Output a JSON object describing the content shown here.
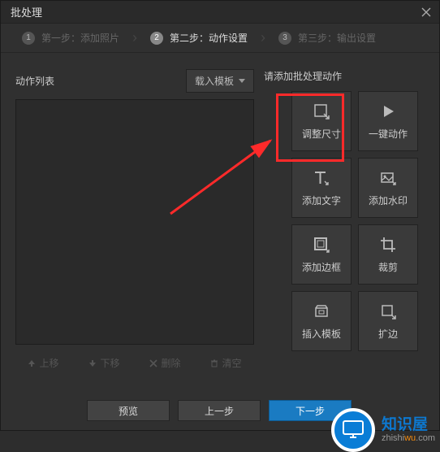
{
  "window": {
    "title": "批处理",
    "close_label": "×"
  },
  "steps": {
    "s1": {
      "num": "1",
      "label": "第一步：添加照片"
    },
    "s2": {
      "num": "2",
      "label": "第二步：动作设置"
    },
    "s3": {
      "num": "3",
      "label": "第三步：输出设置"
    }
  },
  "left": {
    "list_label": "动作列表",
    "template_btn": "载入模板",
    "up": "上移",
    "down": "下移",
    "delete": "删除",
    "clear": "清空"
  },
  "right": {
    "title": "请添加批处理动作",
    "tiles": {
      "resize": "调整尺寸",
      "oneclick": "一键动作",
      "addtext": "添加文字",
      "watermark": "添加水印",
      "border": "添加边框",
      "crop": "裁剪",
      "template": "插入模板",
      "expand": "扩边"
    }
  },
  "footer": {
    "preview": "预览",
    "prev": "上一步",
    "next": "下一步"
  },
  "watermark": {
    "cn": "知识屋",
    "en_pre": "zhishi",
    "en_hi": "wu",
    "en_post": ".com"
  }
}
